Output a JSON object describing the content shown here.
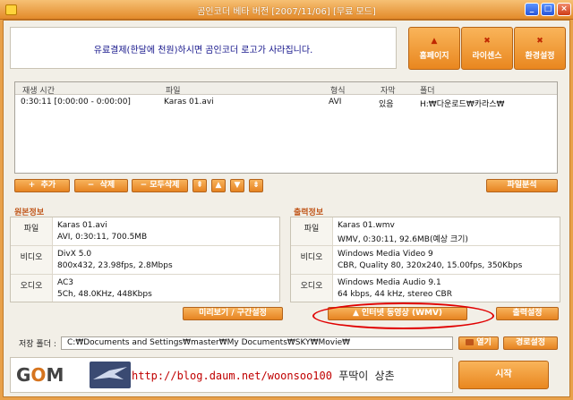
{
  "window": {
    "title": "곰인코더 베타 버전 [2007/11/06] [무료 모드]",
    "controls": [
      "_",
      "□",
      "×"
    ]
  },
  "banner": {
    "text": "유료결제(한달에 천원)하시면 곰인코더 로고가 사라집니다."
  },
  "top_buttons": [
    {
      "label": "홈페이지",
      "icon": "home-icon"
    },
    {
      "label": "라이센스",
      "icon": "license-icon"
    },
    {
      "label": "환경설정",
      "icon": "settings-icon"
    }
  ],
  "file_list": {
    "headers": [
      "재생 시간",
      "파일",
      "형식",
      "자막",
      "폴더"
    ],
    "rows": [
      {
        "duration": "0:30:11 [0:00:00 - 0:00:00]",
        "file": "Karas 01.avi",
        "format": "AVI",
        "subtitle": "있음",
        "folder": "H:₩다운로드₩카라스₩"
      }
    ]
  },
  "list_buttons": {
    "add": "추가",
    "delete": "삭제",
    "delete_all": "모두삭제",
    "add_prefix": "+",
    "delete_prefix": "−",
    "delete_all_prefix": "−",
    "move_top": "⇞",
    "move_up": "▲",
    "move_down": "▼",
    "move_bottom": "⇟",
    "file_analysis": "파일분석"
  },
  "source_info": {
    "title": "원본정보",
    "file_label": "파일",
    "file_line1": "Karas 01.avi",
    "file_line2": "AVI, 0:30:11, 700.5MB",
    "video_label": "비디오",
    "video_line1": "DivX 5.0",
    "video_line2": "800x432, 23.98fps, 2.8Mbps",
    "audio_label": "오디오",
    "audio_line1": "AC3",
    "audio_line2": "5Ch, 48.0KHz, 448Kbps",
    "preview_button": "미리보기 / 구간설정"
  },
  "output_info": {
    "title": "출력정보",
    "file_label": "파일",
    "file_line1": "Karas 01.wmv",
    "file_line2": "WMV, 0:30:11, 92.6MB(예상 크기)",
    "video_label": "비디오",
    "video_line1": "Windows Media Video 9",
    "video_line2": "CBR, Quality 80, 320x240, 15.00fps, 350Kbps",
    "audio_label": "오디오",
    "audio_line1": "Windows Media Audio 9.1",
    "audio_line2": "64 kbps, 44 kHz, stereo CBR",
    "preset_button": "인터넷 동영상 (WMV)",
    "preset_prefix": "▲",
    "output_settings_button": "출력설정"
  },
  "save_folder": {
    "label": "저장 폴더 :",
    "path": "C:₩Documents and Settings₩master₩My Documents₩SKY₩Movie₩",
    "open_button": "열기",
    "change_button": "경로설정"
  },
  "footer": {
    "logo_g": "G",
    "logo_o": "O",
    "logo_m": "M",
    "blog_url": "http://blog.daum.net/woonsoo100",
    "blog_suffix": "푸딱이 상촌",
    "start_button": "시작"
  },
  "colors": {
    "accent": "#e9871f",
    "frame": "#f2efe7",
    "highlight": "#e00000"
  }
}
